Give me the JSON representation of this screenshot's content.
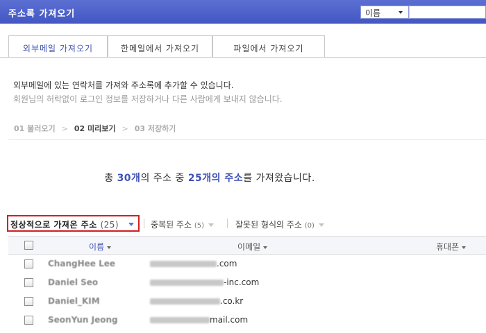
{
  "window": {
    "title": "주소록 가져오기",
    "search_field_select": "이름"
  },
  "tabs": [
    {
      "label": "외부메일 가져오기",
      "active": true
    },
    {
      "label": "한메일에서 가져오기",
      "active": false
    },
    {
      "label": "파일에서 가져오기",
      "active": false
    }
  ],
  "description": {
    "line1": "외부메일에 있는 연락처를 가져와 주소록에 추가할 수 있습니다.",
    "line2": "회원님의 허락없이 로그인 정보를 저장하거나 다른 사람에게 보내지 않습니다."
  },
  "steps": [
    {
      "label": "01 불러오기",
      "current": false
    },
    {
      "label": "02 미리보기",
      "current": true
    },
    {
      "label": "03 저장하기",
      "current": false
    }
  ],
  "summary": {
    "prefix": "총 ",
    "total": "30개",
    "mid1": "의 주소 중 ",
    "imported": "25개의 주소",
    "suffix": "를 가져왔습니다."
  },
  "filters": {
    "normal_label": "정상적으로 가져온 주소",
    "normal_count": "(25)",
    "duplicate_label": "중복된 주소",
    "duplicate_count": "(5)",
    "invalid_label": "잘못된 형식의 주소",
    "invalid_count": "(0)"
  },
  "table": {
    "columns": {
      "name": "이름",
      "email": "이메일",
      "phone": "휴대폰"
    },
    "rows": [
      {
        "name": "ChangHee Lee",
        "email_suffix": ".com"
      },
      {
        "name": "Daniel Seo",
        "email_suffix": "-inc.com"
      },
      {
        "name": "Daniel_KIM",
        "email_suffix": ".co.kr"
      },
      {
        "name": "SeonYun Jeong",
        "email_suffix": "mail.com"
      }
    ]
  },
  "colors": {
    "accent": "#3e51b5",
    "highlight_border": "#d21e1e",
    "titlebar": "#4457c4"
  }
}
